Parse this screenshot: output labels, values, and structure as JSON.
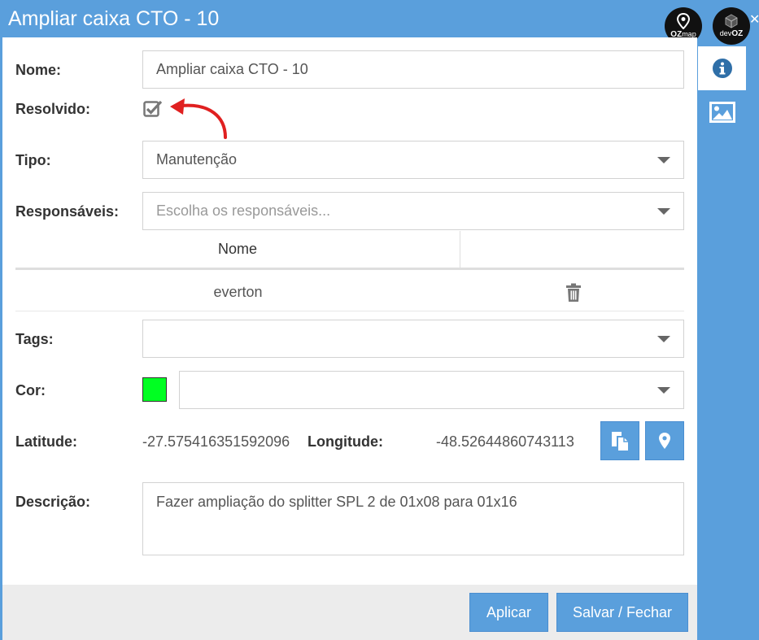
{
  "window": {
    "title": "Ampliar caixa CTO - 10"
  },
  "badges": {
    "ozmap": {
      "label_a": "OZ",
      "label_b": "map"
    },
    "devoz": {
      "label_a": "dev",
      "label_b": "OZ"
    }
  },
  "form": {
    "nome": {
      "label": "Nome:",
      "value": "Ampliar caixa CTO - 10"
    },
    "resolvido": {
      "label": "Resolvido:",
      "checked": true
    },
    "tipo": {
      "label": "Tipo:",
      "value": "Manutenção"
    },
    "responsaveis": {
      "label": "Responsáveis:",
      "placeholder": "Escolha os responsáveis...",
      "table": {
        "header": "Nome",
        "rows": [
          {
            "name": "everton"
          }
        ]
      }
    },
    "tags": {
      "label": "Tags:",
      "value": ""
    },
    "cor": {
      "label": "Cor:",
      "color": "#00ff22",
      "value": ""
    },
    "latitude": {
      "label": "Latitude:",
      "value": "-27.575416351592096"
    },
    "longitude": {
      "label": "Longitude:",
      "value": "-48.52644860743113"
    },
    "descricao": {
      "label": "Descrição:",
      "value": "Fazer ampliação do splitter SPL 2 de 01x08 para 01x16"
    }
  },
  "buttons": {
    "aplicar": "Aplicar",
    "salvar_fechar": "Salvar / Fechar"
  },
  "icons": {
    "sidetabs": [
      "info-icon",
      "image-icon"
    ],
    "coord_actions": [
      "copy-icon",
      "map-marker-icon"
    ],
    "row_actions": [
      "trash-icon"
    ]
  },
  "colors": {
    "accent": "#5a9fdc",
    "annotation_arrow": "#e02020"
  }
}
